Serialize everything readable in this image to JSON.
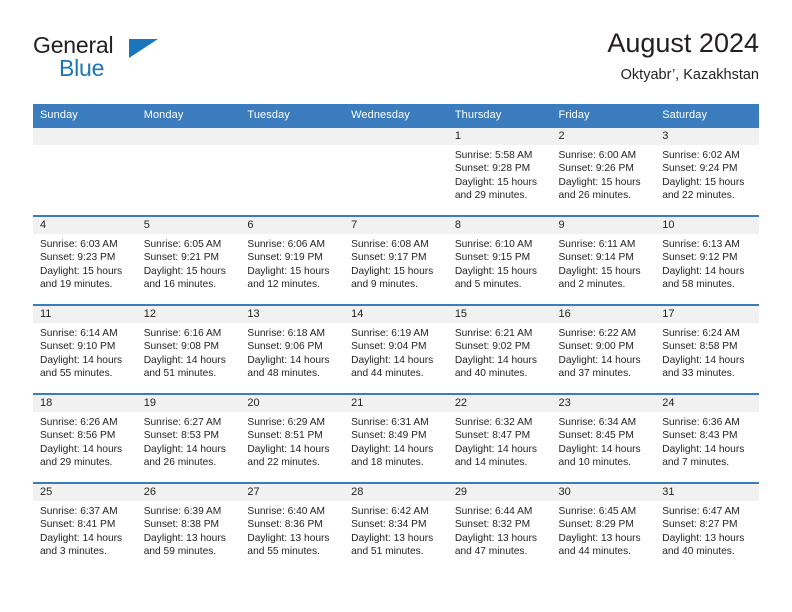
{
  "brand": {
    "name_part1": "General",
    "name_part2": "Blue",
    "triangle_icon": "triangle-icon",
    "accent_color": "#1b75bb"
  },
  "header": {
    "title": "August 2024",
    "subtitle": "Oktyabr’, Kazakhstan"
  },
  "colors": {
    "header_blue": "#3a7cbe",
    "daynum_band": "#f1f1f1",
    "text": "#231f20"
  },
  "weekday_headers": [
    "Sunday",
    "Monday",
    "Tuesday",
    "Wednesday",
    "Thursday",
    "Friday",
    "Saturday"
  ],
  "weeks": [
    [
      {
        "day": "",
        "empty": true,
        "sunrise": "",
        "sunset": "",
        "daylight_line1": "",
        "daylight_line2": ""
      },
      {
        "day": "",
        "empty": true,
        "sunrise": "",
        "sunset": "",
        "daylight_line1": "",
        "daylight_line2": ""
      },
      {
        "day": "",
        "empty": true,
        "sunrise": "",
        "sunset": "",
        "daylight_line1": "",
        "daylight_line2": ""
      },
      {
        "day": "",
        "empty": true,
        "sunrise": "",
        "sunset": "",
        "daylight_line1": "",
        "daylight_line2": ""
      },
      {
        "day": "1",
        "empty": false,
        "sunrise": "Sunrise: 5:58 AM",
        "sunset": "Sunset: 9:28 PM",
        "daylight_line1": "Daylight: 15 hours",
        "daylight_line2": "and 29 minutes."
      },
      {
        "day": "2",
        "empty": false,
        "sunrise": "Sunrise: 6:00 AM",
        "sunset": "Sunset: 9:26 PM",
        "daylight_line1": "Daylight: 15 hours",
        "daylight_line2": "and 26 minutes."
      },
      {
        "day": "3",
        "empty": false,
        "sunrise": "Sunrise: 6:02 AM",
        "sunset": "Sunset: 9:24 PM",
        "daylight_line1": "Daylight: 15 hours",
        "daylight_line2": "and 22 minutes."
      }
    ],
    [
      {
        "day": "4",
        "empty": false,
        "sunrise": "Sunrise: 6:03 AM",
        "sunset": "Sunset: 9:23 PM",
        "daylight_line1": "Daylight: 15 hours",
        "daylight_line2": "and 19 minutes."
      },
      {
        "day": "5",
        "empty": false,
        "sunrise": "Sunrise: 6:05 AM",
        "sunset": "Sunset: 9:21 PM",
        "daylight_line1": "Daylight: 15 hours",
        "daylight_line2": "and 16 minutes."
      },
      {
        "day": "6",
        "empty": false,
        "sunrise": "Sunrise: 6:06 AM",
        "sunset": "Sunset: 9:19 PM",
        "daylight_line1": "Daylight: 15 hours",
        "daylight_line2": "and 12 minutes."
      },
      {
        "day": "7",
        "empty": false,
        "sunrise": "Sunrise: 6:08 AM",
        "sunset": "Sunset: 9:17 PM",
        "daylight_line1": "Daylight: 15 hours",
        "daylight_line2": "and 9 minutes."
      },
      {
        "day": "8",
        "empty": false,
        "sunrise": "Sunrise: 6:10 AM",
        "sunset": "Sunset: 9:15 PM",
        "daylight_line1": "Daylight: 15 hours",
        "daylight_line2": "and 5 minutes."
      },
      {
        "day": "9",
        "empty": false,
        "sunrise": "Sunrise: 6:11 AM",
        "sunset": "Sunset: 9:14 PM",
        "daylight_line1": "Daylight: 15 hours",
        "daylight_line2": "and 2 minutes."
      },
      {
        "day": "10",
        "empty": false,
        "sunrise": "Sunrise: 6:13 AM",
        "sunset": "Sunset: 9:12 PM",
        "daylight_line1": "Daylight: 14 hours",
        "daylight_line2": "and 58 minutes."
      }
    ],
    [
      {
        "day": "11",
        "empty": false,
        "sunrise": "Sunrise: 6:14 AM",
        "sunset": "Sunset: 9:10 PM",
        "daylight_line1": "Daylight: 14 hours",
        "daylight_line2": "and 55 minutes."
      },
      {
        "day": "12",
        "empty": false,
        "sunrise": "Sunrise: 6:16 AM",
        "sunset": "Sunset: 9:08 PM",
        "daylight_line1": "Daylight: 14 hours",
        "daylight_line2": "and 51 minutes."
      },
      {
        "day": "13",
        "empty": false,
        "sunrise": "Sunrise: 6:18 AM",
        "sunset": "Sunset: 9:06 PM",
        "daylight_line1": "Daylight: 14 hours",
        "daylight_line2": "and 48 minutes."
      },
      {
        "day": "14",
        "empty": false,
        "sunrise": "Sunrise: 6:19 AM",
        "sunset": "Sunset: 9:04 PM",
        "daylight_line1": "Daylight: 14 hours",
        "daylight_line2": "and 44 minutes."
      },
      {
        "day": "15",
        "empty": false,
        "sunrise": "Sunrise: 6:21 AM",
        "sunset": "Sunset: 9:02 PM",
        "daylight_line1": "Daylight: 14 hours",
        "daylight_line2": "and 40 minutes."
      },
      {
        "day": "16",
        "empty": false,
        "sunrise": "Sunrise: 6:22 AM",
        "sunset": "Sunset: 9:00 PM",
        "daylight_line1": "Daylight: 14 hours",
        "daylight_line2": "and 37 minutes."
      },
      {
        "day": "17",
        "empty": false,
        "sunrise": "Sunrise: 6:24 AM",
        "sunset": "Sunset: 8:58 PM",
        "daylight_line1": "Daylight: 14 hours",
        "daylight_line2": "and 33 minutes."
      }
    ],
    [
      {
        "day": "18",
        "empty": false,
        "sunrise": "Sunrise: 6:26 AM",
        "sunset": "Sunset: 8:56 PM",
        "daylight_line1": "Daylight: 14 hours",
        "daylight_line2": "and 29 minutes."
      },
      {
        "day": "19",
        "empty": false,
        "sunrise": "Sunrise: 6:27 AM",
        "sunset": "Sunset: 8:53 PM",
        "daylight_line1": "Daylight: 14 hours",
        "daylight_line2": "and 26 minutes."
      },
      {
        "day": "20",
        "empty": false,
        "sunrise": "Sunrise: 6:29 AM",
        "sunset": "Sunset: 8:51 PM",
        "daylight_line1": "Daylight: 14 hours",
        "daylight_line2": "and 22 minutes."
      },
      {
        "day": "21",
        "empty": false,
        "sunrise": "Sunrise: 6:31 AM",
        "sunset": "Sunset: 8:49 PM",
        "daylight_line1": "Daylight: 14 hours",
        "daylight_line2": "and 18 minutes."
      },
      {
        "day": "22",
        "empty": false,
        "sunrise": "Sunrise: 6:32 AM",
        "sunset": "Sunset: 8:47 PM",
        "daylight_line1": "Daylight: 14 hours",
        "daylight_line2": "and 14 minutes."
      },
      {
        "day": "23",
        "empty": false,
        "sunrise": "Sunrise: 6:34 AM",
        "sunset": "Sunset: 8:45 PM",
        "daylight_line1": "Daylight: 14 hours",
        "daylight_line2": "and 10 minutes."
      },
      {
        "day": "24",
        "empty": false,
        "sunrise": "Sunrise: 6:36 AM",
        "sunset": "Sunset: 8:43 PM",
        "daylight_line1": "Daylight: 14 hours",
        "daylight_line2": "and 7 minutes."
      }
    ],
    [
      {
        "day": "25",
        "empty": false,
        "sunrise": "Sunrise: 6:37 AM",
        "sunset": "Sunset: 8:41 PM",
        "daylight_line1": "Daylight: 14 hours",
        "daylight_line2": "and 3 minutes."
      },
      {
        "day": "26",
        "empty": false,
        "sunrise": "Sunrise: 6:39 AM",
        "sunset": "Sunset: 8:38 PM",
        "daylight_line1": "Daylight: 13 hours",
        "daylight_line2": "and 59 minutes."
      },
      {
        "day": "27",
        "empty": false,
        "sunrise": "Sunrise: 6:40 AM",
        "sunset": "Sunset: 8:36 PM",
        "daylight_line1": "Daylight: 13 hours",
        "daylight_line2": "and 55 minutes."
      },
      {
        "day": "28",
        "empty": false,
        "sunrise": "Sunrise: 6:42 AM",
        "sunset": "Sunset: 8:34 PM",
        "daylight_line1": "Daylight: 13 hours",
        "daylight_line2": "and 51 minutes."
      },
      {
        "day": "29",
        "empty": false,
        "sunrise": "Sunrise: 6:44 AM",
        "sunset": "Sunset: 8:32 PM",
        "daylight_line1": "Daylight: 13 hours",
        "daylight_line2": "and 47 minutes."
      },
      {
        "day": "30",
        "empty": false,
        "sunrise": "Sunrise: 6:45 AM",
        "sunset": "Sunset: 8:29 PM",
        "daylight_line1": "Daylight: 13 hours",
        "daylight_line2": "and 44 minutes."
      },
      {
        "day": "31",
        "empty": false,
        "sunrise": "Sunrise: 6:47 AM",
        "sunset": "Sunset: 8:27 PM",
        "daylight_line1": "Daylight: 13 hours",
        "daylight_line2": "and 40 minutes."
      }
    ]
  ]
}
